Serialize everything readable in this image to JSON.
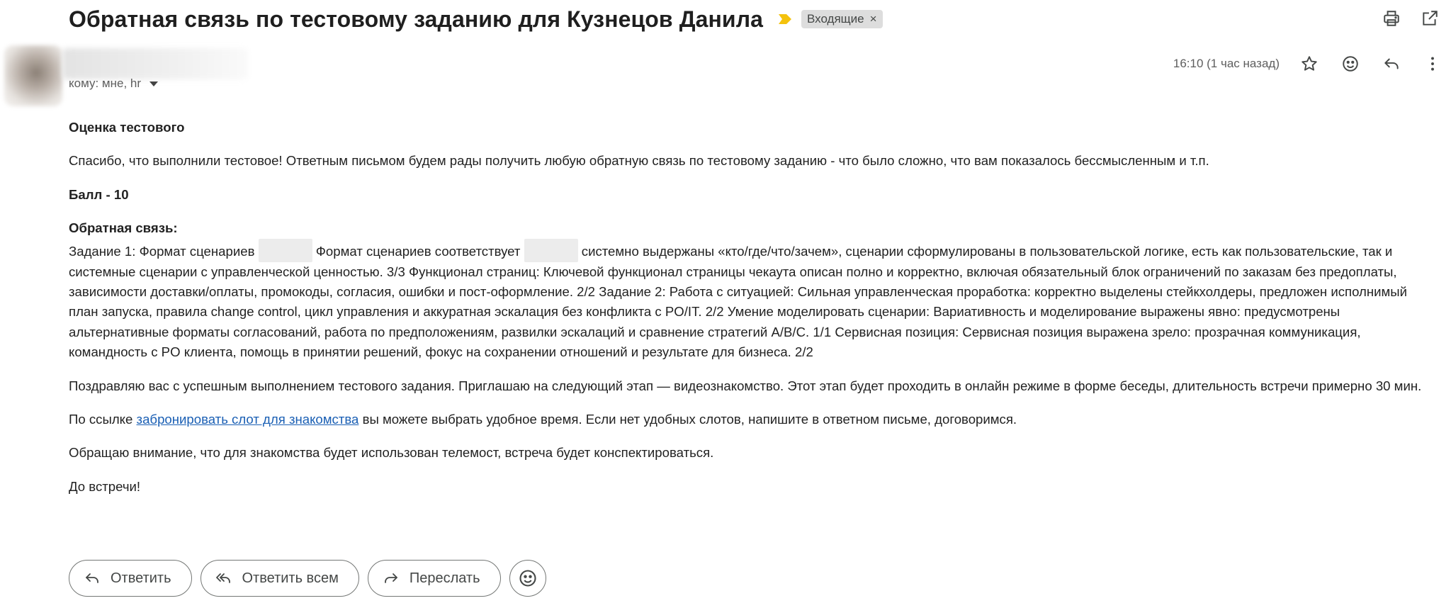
{
  "email": {
    "subject": "Обратная связь по тестовому заданию для Кузнецов Данила",
    "label": "Входящие",
    "label_remove": "×",
    "recipients": "кому: мне, hr",
    "time": "16:10 (1 час назад)"
  },
  "body": {
    "heading": "Оценка тестового",
    "p1": "Спасибо, что выполнили тестовое! Ответным письмом будем рады получить любую обратную связь по тестовому заданию - что было сложно, что вам показалось бессмысленным и т.п.",
    "score": "Балл - 10",
    "feedback_title": "Обратная связь:",
    "feedback_seg1": "Задание 1: Формат сценариев",
    "feedback_seg2": "Формат сценариев соответствует",
    "feedback_seg3": "системно выдержаны «кто/где/что/зачем», сценарии сформулированы в пользовательской логике, есть как пользовательские, так и системные сценарии с управленческой ценностью. 3/3 Функционал страниц: Ключевой функционал страницы чекаута описан полно и корректно, включая обязательный блок ограничений по заказам без предоплаты, зависимости доставки/оплаты, промокоды, согласия, ошибки и пост-оформление. 2/2 Задание 2: Работа с ситуацией: Сильная управленческая проработка: корректно выделены стейкхолдеры, предложен исполнимый план запуска, правила change control, цикл управления и аккуратная эскалация без конфликта с PO/IT. 2/2 Умение моделировать сценарии: Вариативность и моделирование выражены явно: предусмотрены альтернативные форматы согласований, работа по предположениям, развилки эскалаций и сравнение стратегий A/B/C. 1/1 Сервисная позиция: Сервисная позиция выражена зрело: прозрачная коммуникация, командность с PO клиента, помощь в принятии решений, фокус на сохранении отношений и результате для бизнеса. 2/2",
    "p2": "Поздравляю вас с успешным выполнением тестового задания. Приглашаю на следующий этап — видеознакомство. Этот этап будет проходить в онлайн режиме в форме беседы, длительность встречи примерно 30 мин.",
    "p3_before": "По ссылке",
    "p3_link": "забронировать слот для знакомства",
    "p3_after": "вы можете выбрать удобное время. Если нет удобных слотов, напишите в ответном письме, договоримся.",
    "p4": "Обращаю внимание, что для знакомства будет использован телемост, встреча будет конспектироваться.",
    "p5": "До встречи!"
  },
  "actions": {
    "reply": "Ответить",
    "reply_all": "Ответить всем",
    "forward": "Переслать"
  },
  "icons": {
    "importance": "importance-marker-icon",
    "print": "print-icon",
    "open_new_window": "open-in-new-window-icon",
    "star": "star-icon",
    "emoji": "emoji-icon",
    "reply": "reply-icon",
    "more": "more-vertical-icon",
    "reply_all": "reply-all-icon",
    "forward": "forward-icon"
  },
  "colors": {
    "importance": "#f4c20d",
    "link": "#1a5fb4",
    "label_bg": "#dddddd"
  }
}
